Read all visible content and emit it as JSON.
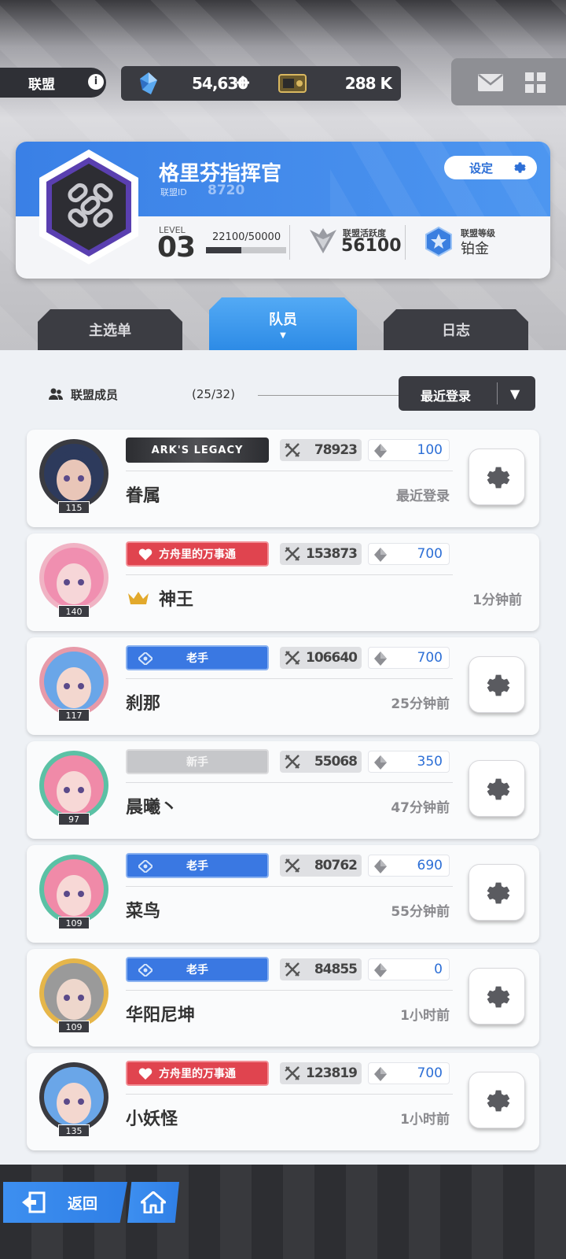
{
  "topbar": {
    "alliance_label": "联盟",
    "crystal_amount": "54,630",
    "plus_symbol": "+",
    "ticket_amount": "288 K"
  },
  "profile": {
    "commander_name": "格里芬指挥官",
    "alliance_id_label": "联盟ID",
    "alliance_id": "8720",
    "settings_label": "设定",
    "level_label": "LEVEL",
    "level": "03",
    "exp_text": "22100/50000",
    "exp_fraction": 0.442,
    "activity_label": "联盟活跃度",
    "activity_value": "56100",
    "rank_label": "联盟等级",
    "rank_value": "铂金"
  },
  "tabs": [
    {
      "label": "主选单",
      "active": false
    },
    {
      "label": "队员",
      "active": true
    },
    {
      "label": "日志",
      "active": false
    }
  ],
  "members_header": {
    "label": "联盟成员",
    "count": "(25/32)",
    "sort_label": "最近登录"
  },
  "members": [
    {
      "level": "115",
      "tag": "ARK'S LEGACY",
      "tag_style": "dark",
      "power": "78923",
      "contribution": "100",
      "name": "眷属",
      "time": "最近登录",
      "crown": false,
      "gear": true
    },
    {
      "level": "140",
      "tag": "方舟里的万事通",
      "tag_style": "red",
      "power": "153873",
      "contribution": "700",
      "name": "神王",
      "time": "1分钟前",
      "crown": true,
      "gear": false
    },
    {
      "level": "117",
      "tag": "老手",
      "tag_style": "blue",
      "power": "106640",
      "contribution": "700",
      "name": "刹那",
      "time": "25分钟前",
      "crown": false,
      "gear": true
    },
    {
      "level": "97",
      "tag": "新手",
      "tag_style": "gray",
      "power": "55068",
      "contribution": "350",
      "name": "晨曦丶",
      "time": "47分钟前",
      "crown": false,
      "gear": true
    },
    {
      "level": "109",
      "tag": "老手",
      "tag_style": "blue",
      "power": "80762",
      "contribution": "690",
      "name": "菜鸟",
      "time": "55分钟前",
      "crown": false,
      "gear": true
    },
    {
      "level": "109",
      "tag": "老手",
      "tag_style": "blue",
      "power": "84855",
      "contribution": "0",
      "name": "华阳尼坤",
      "time": "1小时前",
      "crown": false,
      "gear": true
    },
    {
      "level": "135",
      "tag": "方舟里的万事通",
      "tag_style": "red",
      "power": "123819",
      "contribution": "700",
      "name": "小妖怪",
      "time": "1小时前",
      "crown": false,
      "gear": true
    }
  ],
  "bottom": {
    "back_label": "返回"
  },
  "colors": {
    "accent_blue": "#3a80e6",
    "tag_red": "#e0444f",
    "dark_panel": "#3a3b41"
  }
}
